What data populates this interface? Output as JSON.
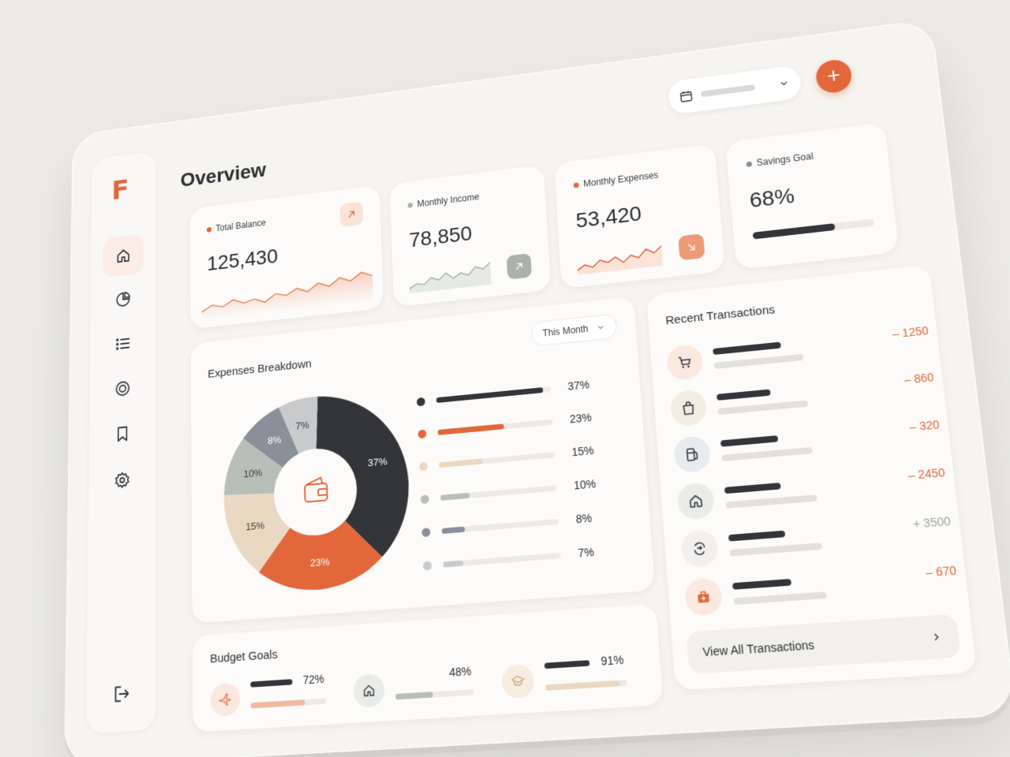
{
  "page": {
    "title": "Overview"
  },
  "header": {
    "date_picker_value": "",
    "add_label": "+"
  },
  "sidebar": {
    "logo": "F",
    "items": [
      {
        "icon": "home-icon",
        "active": true
      },
      {
        "icon": "pie-chart-icon",
        "active": false
      },
      {
        "icon": "list-icon",
        "active": false
      },
      {
        "icon": "target-icon",
        "active": false
      },
      {
        "icon": "bookmark-icon",
        "active": false
      },
      {
        "icon": "settings-icon",
        "active": false
      }
    ],
    "logout_icon": "logout-icon"
  },
  "stats": [
    {
      "label": "Total Balance",
      "value": "125,430",
      "dot_color": "#e2673a",
      "trend": "up"
    },
    {
      "label": "Monthly Income",
      "value": "78,850",
      "dot_color": "#a9b3ab",
      "trend": "up"
    },
    {
      "label": "Monthly Expenses",
      "value": "53,420",
      "dot_color": "#e2673a",
      "trend": "down"
    },
    {
      "label": "Savings Goal",
      "value": "68%",
      "dot_color": "#8a8d96",
      "progress": 0.68
    }
  ],
  "expenses": {
    "title": "Expenses Breakdown",
    "filter": "This Month",
    "center_icon": "wallet-icon",
    "colors": {
      "accent": "#e2673a",
      "dark": "#34353a"
    }
  },
  "chart_data": {
    "type": "pie",
    "categories": [
      "",
      "",
      "",
      "",
      "",
      ""
    ],
    "values": [
      37,
      23,
      15,
      10,
      8,
      7
    ],
    "labels": [
      "37%",
      "23%",
      "15%",
      "10%",
      "8%",
      "7%"
    ],
    "colors": [
      "#34353a",
      "#e2673a",
      "#ead9c2",
      "#b7bfb8",
      "#8a8f9a",
      "#c9cacc"
    ]
  },
  "transactions": {
    "title": "Recent Transactions",
    "items": [
      {
        "icon": "cart-icon",
        "amount": "– 1250",
        "type": "expense",
        "bg": "#fbe8df"
      },
      {
        "icon": "shopping-bag-icon",
        "amount": "– 860",
        "type": "expense",
        "bg": "#f3ece3"
      },
      {
        "icon": "fuel-icon",
        "amount": "– 320",
        "type": "expense",
        "bg": "#e8ebef"
      },
      {
        "icon": "home-icon",
        "amount": "– 2450",
        "type": "expense",
        "bg": "#e9ece8"
      },
      {
        "icon": "transfer-icon",
        "amount": "+ 3500",
        "type": "income",
        "bg": "#f1f0ee"
      },
      {
        "icon": "medical-icon",
        "amount": "– 670",
        "type": "expense",
        "bg": "#fbe8df"
      }
    ],
    "view_all": "View All Transactions"
  },
  "budget_goals": {
    "title": "Budget Goals",
    "items": [
      {
        "icon": "plane-icon",
        "pct": "72%",
        "progress": 0.72,
        "color": "#f2b9a2",
        "bg": "#fbe8df"
      },
      {
        "icon": "house-icon",
        "pct": "48%",
        "progress": 0.48,
        "color": "#b7bfb8",
        "bg": "#e9ece8"
      },
      {
        "icon": "graduation-icon",
        "pct": "91%",
        "progress": 0.91,
        "color": "#ead9c2",
        "bg": "#f6ece0"
      }
    ]
  }
}
